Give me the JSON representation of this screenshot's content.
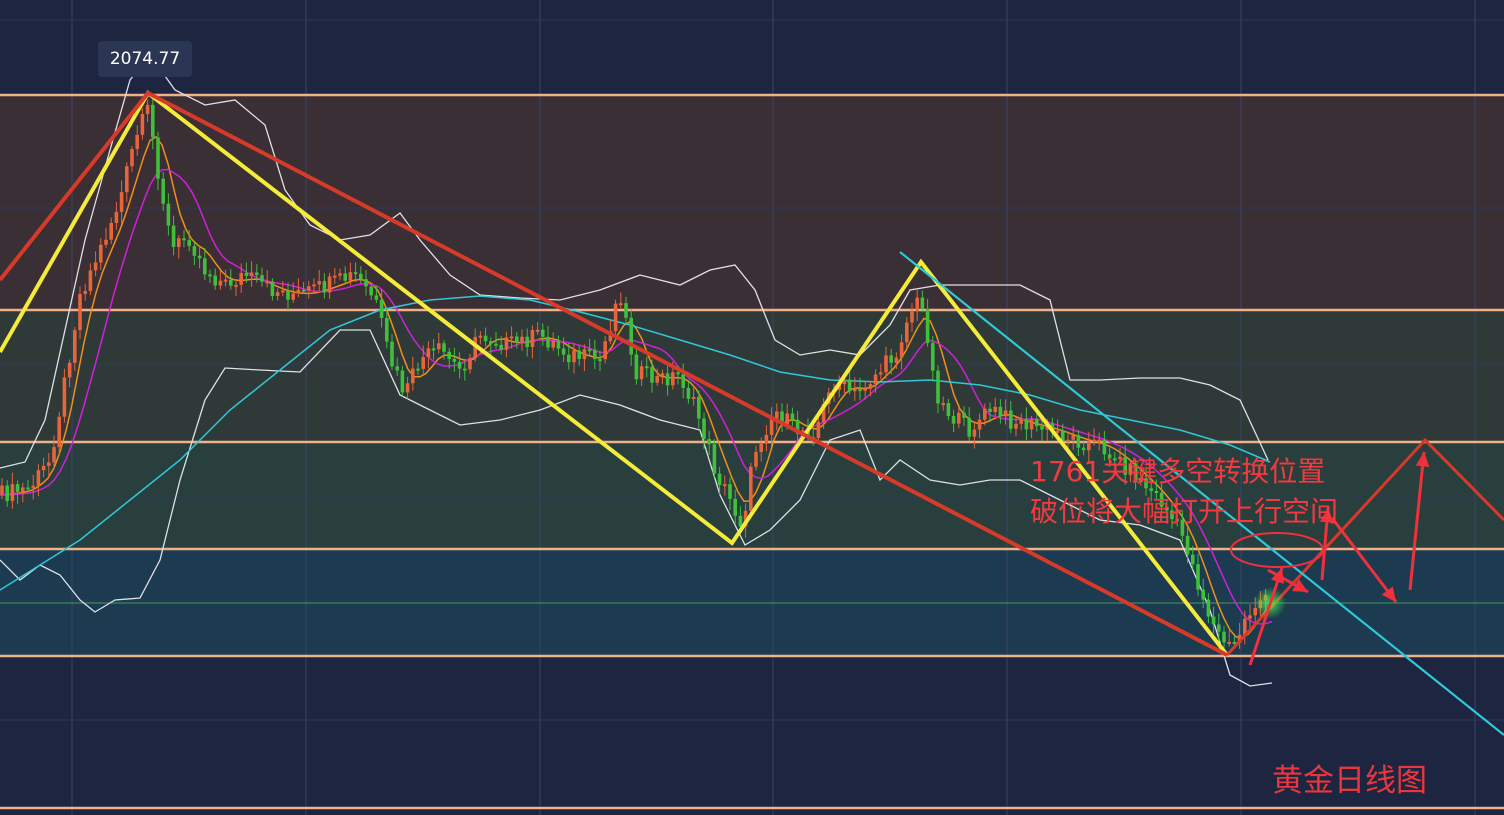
{
  "title": "黄金日线图",
  "annotation": {
    "line1": "1761关键多空转换位置",
    "line2": "破位将大幅打开上行空间"
  },
  "peak_label": "2074.77",
  "colors": {
    "background": "#1d2540",
    "level_line": "#f0b088",
    "zone_top": "#3a2f35",
    "zone_upper": "#2f3a38",
    "zone_mid": "#283f3e",
    "zone_lower": "#1c3a50",
    "up_candle": "#e8643a",
    "down_candle": "#3fbf3a",
    "ma_fast": "#f0901a",
    "ma_mid": "#d020d8",
    "ma_slow": "#30c8d8",
    "bollinger": "#e0e0e8",
    "wave_yellow": "#f5ec3a",
    "trend_red": "#d83a2a",
    "arrow_red": "#f0303a",
    "text_red": "#f23a3f"
  },
  "chart_data": {
    "type": "candlestick",
    "title": "黄金日线图",
    "instrument": "gold daily",
    "peak_value": 2074.77,
    "key_level": 1761,
    "horizontal_levels": 6,
    "zones": 4,
    "indicators": [
      "moving averages (3)",
      "bollinger bands"
    ],
    "wave_pattern": "zigzag",
    "grid": true,
    "legend": "none"
  }
}
